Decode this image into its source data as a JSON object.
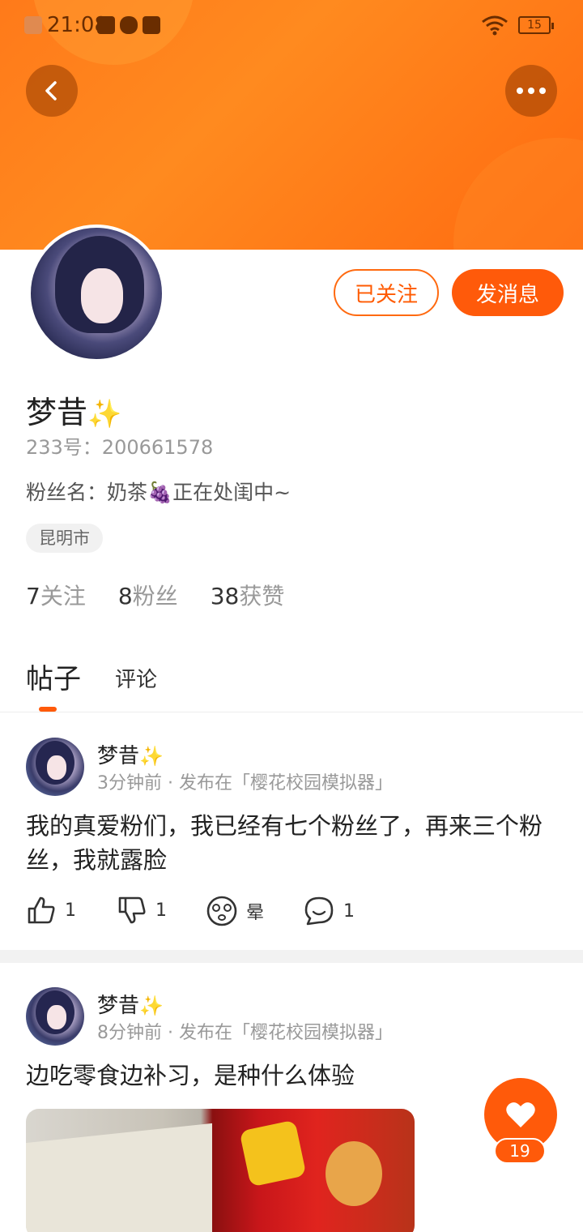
{
  "status_bar": {
    "time": "21:08",
    "battery": "15"
  },
  "header": {
    "back_icon": "chevron-left-icon",
    "more_icon": "more-dots-icon"
  },
  "profile": {
    "name": "梦昔",
    "name_emoji": "✨",
    "uid_text": "233号：200661578",
    "bio_prefix": "粉丝名：奶茶",
    "bio_emoji": "🍇",
    "bio_suffix": "正在处闺中~",
    "location": "昆明市",
    "follow_button": "已关注",
    "message_button": "发消息",
    "stats": [
      {
        "num": "7",
        "label": "关注"
      },
      {
        "num": "8",
        "label": "粉丝"
      },
      {
        "num": "38",
        "label": "获赞"
      }
    ]
  },
  "tabs": {
    "posts": "帖子",
    "comments": "评论"
  },
  "posts": [
    {
      "author": "梦昔",
      "author_emoji": "✨",
      "meta": "3分钟前 · 发布在「樱花校园模拟器」",
      "text": "我的真爱粉们，我已经有七个粉丝了，再来三个粉丝，我就露脸",
      "likes": "1",
      "dislikes": "1",
      "reaction_label": "晕",
      "comments": "1"
    },
    {
      "author": "梦昔",
      "author_emoji": "✨",
      "meta": "8分钟前 · 发布在「樱花校园模拟器」",
      "text": "边吃零食边补习，是种什么体验"
    }
  ],
  "fab": {
    "icon": "heart-icon",
    "count": "19"
  },
  "colors": {
    "accent": "#ff5a0a",
    "header": "#ff7a1a"
  }
}
